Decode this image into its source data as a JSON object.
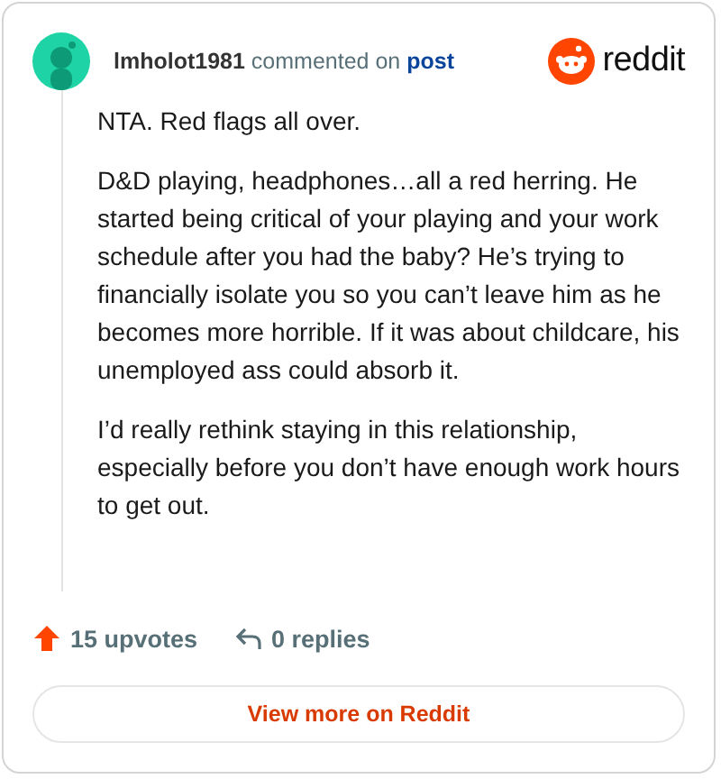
{
  "comment": {
    "author": "lmholot1981",
    "action": "commented on",
    "link": "post",
    "brand": "reddit",
    "paragraphs": [
      "NTA. Red flags all over.",
      "D&D playing, headphones…all a red herring. He started being critical of your playing and your work schedule after you had the baby? He’s trying to financially isolate you so you can’t leave him as he becomes more horrible. If it was about childcare, his unemployed ass could absorb it.",
      "I’d really rethink staying in this relationship, especially before you don’t have enough work hours to get out."
    ],
    "upvotes": "15 upvotes",
    "replies": "0 replies"
  },
  "button": "View more on Reddit"
}
